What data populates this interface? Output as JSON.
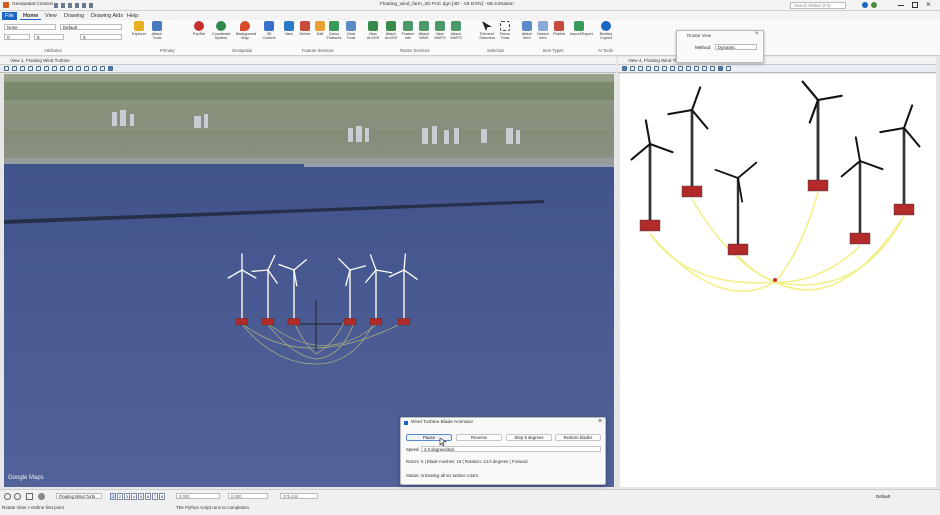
{
  "app": {
    "title": "Floating_wind_farm_3D PoC.dgn [3D - V8 DGN] - MicroStation",
    "context": "Geospatial Context",
    "search_placeholder": "Search Ribbon (F4)"
  },
  "tabs": [
    "File",
    "Home",
    "View",
    "Drawing",
    "Drawing Aids",
    "Help"
  ],
  "attributes": {
    "level": "None",
    "style": "Default",
    "weight": "0",
    "color": "0",
    "transparency": "0",
    "label": "Attributes"
  },
  "ribbon": {
    "groups": [
      "Attributes",
      "Primary",
      "Geospatial",
      "Feature Services",
      "Raster Services",
      "Selection",
      "Item Types",
      "AI Tools"
    ],
    "buttons": [
      "Explorer",
      "Attach Tools",
      "PopSet",
      "Coordinate System",
      "Background Map",
      "3D Context",
      "New",
      "Delete",
      "Edit",
      "Query Features",
      "Clear Tools",
      "New ArcGIS",
      "Attach ArcGIS",
      "Feature Info",
      "Attach WMS",
      "New WMTS",
      "Attach WMTS",
      "Element Selection",
      "Fence Tools",
      "Attach Item",
      "Detach Item",
      "Picklist",
      "Import/Export",
      "Bentley Copilot"
    ]
  },
  "view1": {
    "title": "View 1, Floating Wind Turbine",
    "map_credit": "Google Maps"
  },
  "view4": {
    "title": "View 4, Floating Wind Turb"
  },
  "rotate_view": {
    "title": "Rotate View",
    "method_label": "Method:",
    "method_value": "Dynamic"
  },
  "dialog": {
    "title": "Wind Turbine Blade Animator",
    "buttons": [
      "Pause",
      "Reverse",
      "Step 5 degrees",
      "Restore blades"
    ],
    "speed_label": "Speed:",
    "speed_value": "2.0 degrees/tick",
    "info": "Rotors: 6 | Blade meshes: 18 | Rotation: 14.0 degrees | Forward",
    "status": "Status: Animating all six turbine rotors."
  },
  "statusbar": {
    "view_select": "Floating Wind Turbi",
    "x": "0.000",
    "y": "0.000",
    "z": "275.444",
    "default_label": "Default",
    "prompt": "Rotate View > Define first point",
    "message": "The Python script runs to completion",
    "view_numbers": [
      "1",
      "2",
      "3",
      "4",
      "5",
      "6",
      "7",
      "8"
    ]
  },
  "colors": {
    "ribbon_accent": "#1a66c4",
    "sea": "#4a5a8e",
    "sky": "#b8c4d0",
    "cable": "#f3f08a",
    "platform": "#b32a2a"
  }
}
